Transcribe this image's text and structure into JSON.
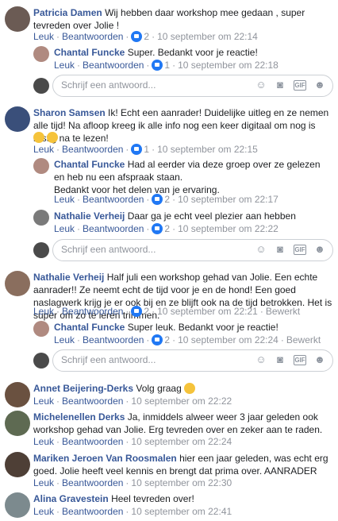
{
  "labels": {
    "like": "Leuk",
    "reply": "Beantwoorden",
    "edited": "Bewerkt",
    "reply_placeholder": "Schrijf een antwoord..."
  },
  "threads": [
    {
      "author": "Patricia Damen",
      "text": "Wij hebben daar workshop mee gedaan , super tevreden over Jolie !",
      "likes": "2",
      "time": "10 september om 22:14",
      "replies": [
        {
          "author": "Chantal Funcke",
          "text": "Super. Bedankt voor je reactie!",
          "likes": "1",
          "time": "10 september om 22:18"
        }
      ]
    },
    {
      "author": "Sharon Samsen",
      "text": "Ik! Echt een aanrader! Duidelijke uitleg en ze nemen alle tijd! Na afloop kreeg ik alle info nog een keer digitaal om nog is rustig na te lezen!",
      "likes": "1",
      "time": "10 september om 22:15",
      "replies": [
        {
          "author": "Chantal Funcke",
          "text": "Had al eerder via deze groep over ze gelezen en heb nu een afspraak staan.",
          "text2": "Bedankt voor het delen van je ervaring.",
          "likes": "2",
          "time": "10 september om 22:17"
        },
        {
          "author": "Nathalie Verheij",
          "text": "Daar ga je echt veel plezier aan hebben",
          "likes": "2",
          "time": "10 september om 22:22"
        }
      ]
    },
    {
      "author": "Nathalie Verheij",
      "text": "Half juli een workshop gehad van Jolie. Een echte aanrader!! Ze neemt echt de tijd voor je en de hond! Een goed naslagwerk krijg je er ook bij en ze blijft ook na de tijd betrokken. Het is super om zo te leren trimmen.",
      "likes": "2",
      "time": "10 september om 22:21",
      "replies": [
        {
          "author": "Chantal Funcke",
          "text": "Super leuk. Bedankt voor je reactie!",
          "likes": "2",
          "time": "10 september om 22:24"
        }
      ]
    },
    {
      "author": "Annet Beijering-Derks",
      "text": "Volg graag",
      "time": "10 september om 22:22"
    },
    {
      "author": "Michelenellen Derks",
      "text": "Ja, inmiddels alweer weer 3 jaar geleden ook workshop gehad van Jolie. Erg tevreden over en zeker aan te raden.",
      "time": "10 september om 22:24"
    },
    {
      "author": "Mariken Jeroen Van Roosmalen",
      "text": "hier een jaar geleden, was echt erg goed. Jolie heeft veel kennis en brengt dat prima over. AANRADER",
      "time": "10 september om 22:30"
    },
    {
      "author": "Alina Gravestein",
      "text": "Heel tevreden over!",
      "time": "10 september om 22:41"
    }
  ]
}
